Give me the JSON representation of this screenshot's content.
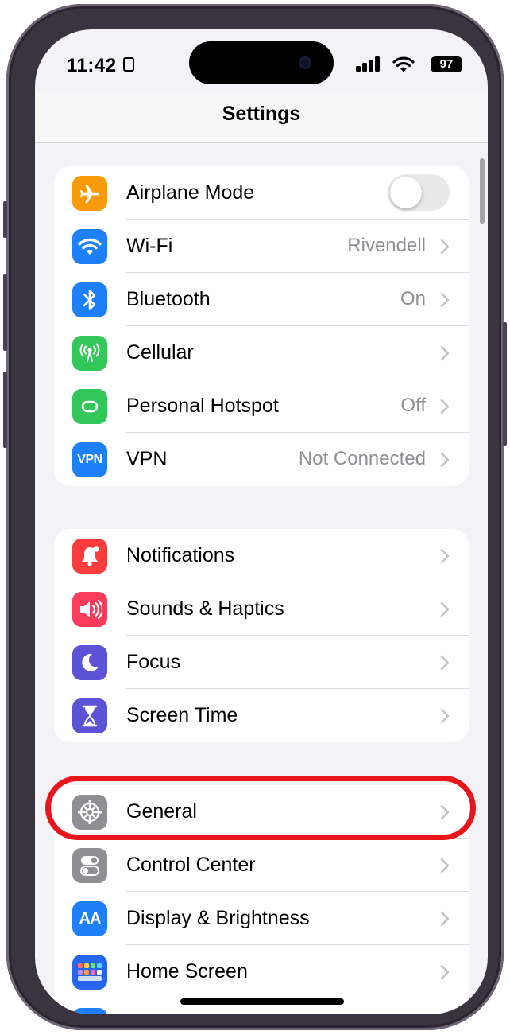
{
  "status_bar": {
    "time": "11:42",
    "battery": "97"
  },
  "nav": {
    "title": "Settings"
  },
  "colors": {
    "airplane": "#f99a0a",
    "wifi": "#1e80f8",
    "bluetooth": "#1e80f8",
    "cellular": "#33c759",
    "hotspot": "#33c759",
    "vpn": "#1e80f8",
    "notifications": "#fa3c3c",
    "sounds": "#fa3b5c",
    "focus": "#5b52d6",
    "screen_time": "#5b52d6",
    "general": "#8e8e93",
    "control_center": "#8e8e93",
    "display": "#1e80f8",
    "home_screen": "#2466ee",
    "highlight": "#e8151b"
  },
  "groups": [
    {
      "rows": [
        {
          "label": "Airplane Mode",
          "icon": "airplane-icon",
          "toggle_on": false
        },
        {
          "label": "Wi-Fi",
          "icon": "wifi-icon",
          "value": "Rivendell"
        },
        {
          "label": "Bluetooth",
          "icon": "bluetooth-icon",
          "value": "On"
        },
        {
          "label": "Cellular",
          "icon": "cellular-antenna-icon",
          "value": ""
        },
        {
          "label": "Personal Hotspot",
          "icon": "hotspot-chain-icon",
          "value": "Off"
        },
        {
          "label": "VPN",
          "icon": "vpn-icon",
          "icon_text": "VPN",
          "value": "Not Connected"
        }
      ]
    },
    {
      "rows": [
        {
          "label": "Notifications",
          "icon": "bell-icon"
        },
        {
          "label": "Sounds & Haptics",
          "icon": "speaker-icon"
        },
        {
          "label": "Focus",
          "icon": "moon-icon"
        },
        {
          "label": "Screen Time",
          "icon": "hourglass-icon"
        }
      ]
    },
    {
      "rows": [
        {
          "label": "General",
          "icon": "gear-icon",
          "highlighted": true
        },
        {
          "label": "Control Center",
          "icon": "toggles-icon"
        },
        {
          "label": "Display & Brightness",
          "icon": "text-size-icon",
          "icon_text": "AA"
        },
        {
          "label": "Home Screen",
          "icon": "app-grid-icon"
        }
      ]
    }
  ]
}
